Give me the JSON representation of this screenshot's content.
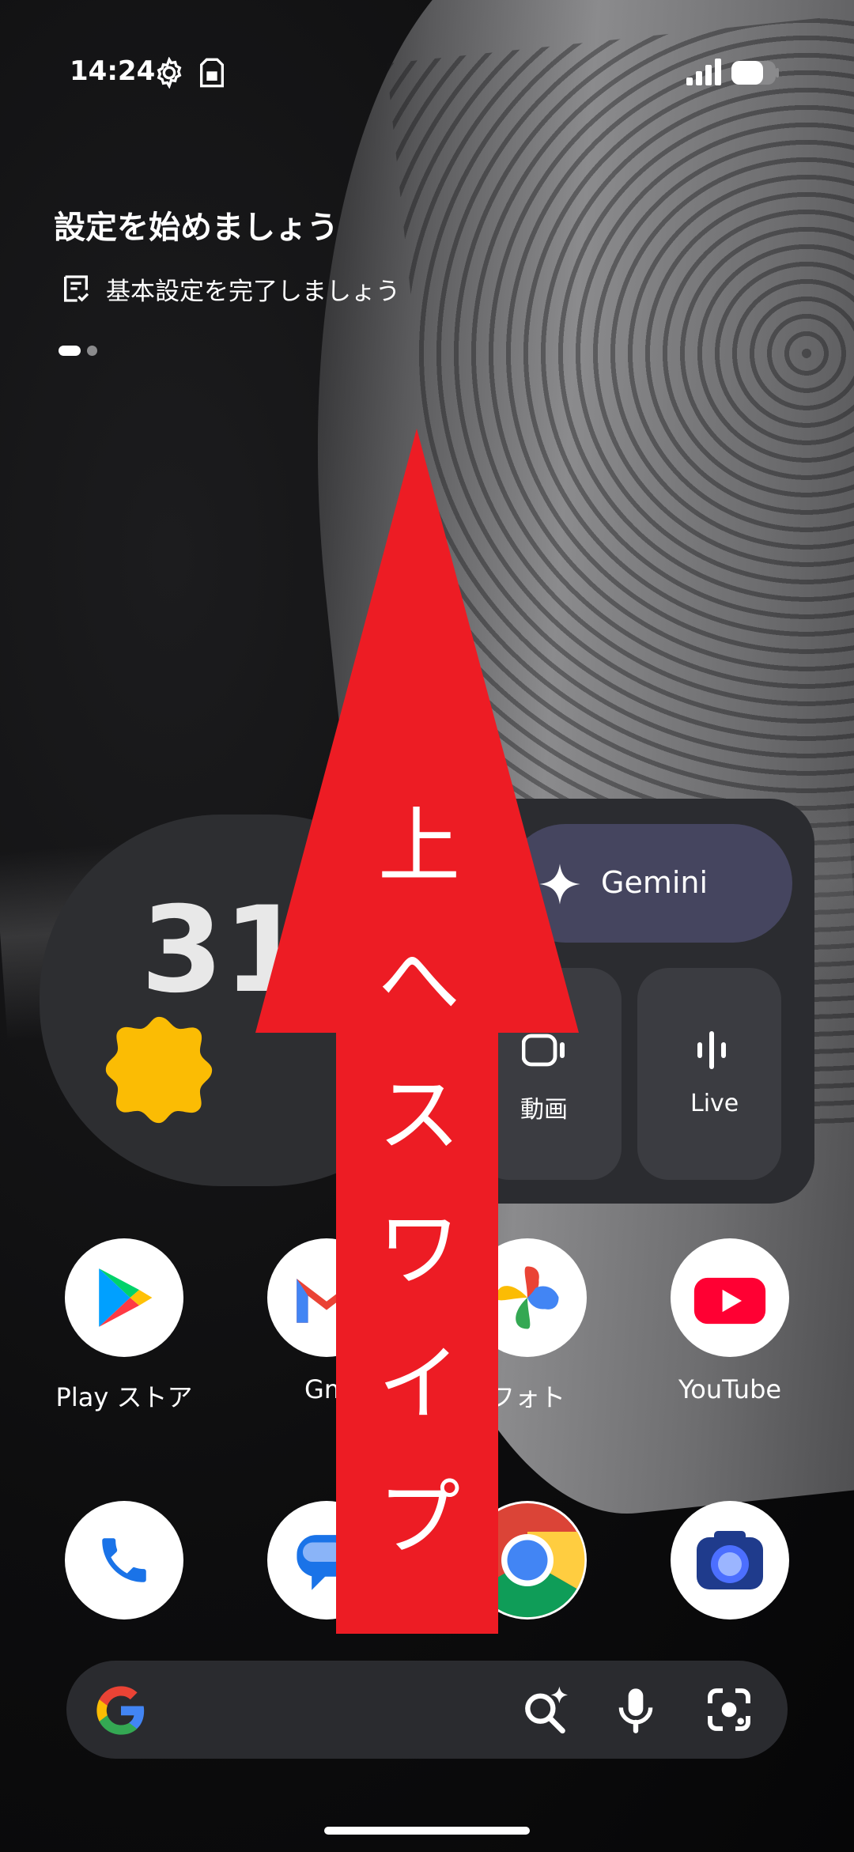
{
  "status_bar": {
    "time": "14:24",
    "icons": [
      "gear-icon",
      "sim-card-icon",
      "signal-icon",
      "battery-icon"
    ]
  },
  "setup_card": {
    "title": "設定を始めましょう",
    "item": "基本設定を完了しましょう",
    "page_indicator": {
      "pages": 2,
      "current": 1
    }
  },
  "weather": {
    "temperature": "31",
    "condition_icon": "sun-icon"
  },
  "gemini_widget": {
    "label": "Gemini",
    "tiles": [
      {
        "label": "動画",
        "icon": "video-icon"
      },
      {
        "label": "Live",
        "icon": "live-waveform-icon"
      }
    ]
  },
  "apps_row1": [
    {
      "label": "Play ストア",
      "icon": "play-store-icon"
    },
    {
      "label": "Gm",
      "icon": "gmail-icon"
    },
    {
      "label": "フォト",
      "icon": "photos-icon"
    },
    {
      "label": "YouTube",
      "icon": "youtube-icon"
    }
  ],
  "apps_row2": [
    {
      "label": "",
      "icon": "phone-icon"
    },
    {
      "label": "",
      "icon": "messages-icon"
    },
    {
      "label": "",
      "icon": "chrome-icon"
    },
    {
      "label": "",
      "icon": "camera-icon"
    }
  ],
  "search_bar": {
    "icons": [
      "google-g-icon",
      "ai-search-icon",
      "mic-icon",
      "lens-icon"
    ]
  },
  "overlay": {
    "text": "上へスワイプ",
    "chars": [
      "上",
      "へ",
      "ス",
      "ワ",
      "イ",
      "プ"
    ],
    "color": "#ed1c24"
  }
}
